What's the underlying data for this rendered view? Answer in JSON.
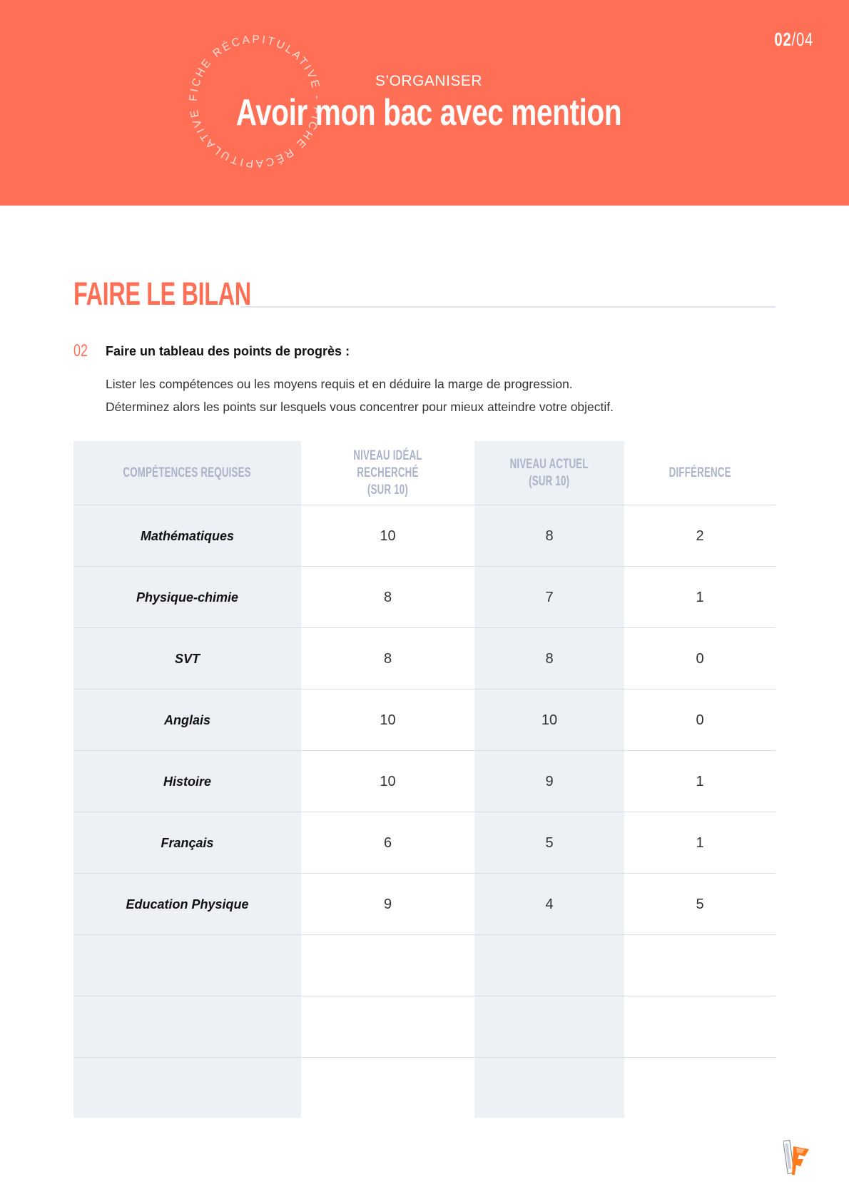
{
  "header": {
    "page_current": "02",
    "page_separator": "/",
    "page_total": "04",
    "stamp_text": "FICHE RÉCAPITULATIVE - FICHE RÉCAPITULATIVE - ",
    "kicker": "S’ORGANISER",
    "title": "Avoir mon bac avec mention",
    "banner_color": "#ff6f55"
  },
  "section": {
    "title": "FAIRE LE BILAN"
  },
  "step": {
    "number": "02",
    "title": "Faire un tableau des points de progrès :",
    "line1": "Lister les compétences ou les moyens requis et en déduire la marge de progression.",
    "line2": "Déterminez alors les points sur lesquels vous concentrer pour mieux atteindre votre objectif."
  },
  "table": {
    "headers": [
      "COMPÉTENCES REQUISES",
      "NIVEAU IDÉAL RECHERCHÉ\n(SUR 10)",
      "NIVEAU ACTUEL\n(SUR 10)",
      "DIFFÉRENCE"
    ],
    "rows": [
      {
        "subject": "Mathématiques",
        "ideal": "10",
        "current": "8",
        "diff": "2"
      },
      {
        "subject": "Physique-chimie",
        "ideal": "8",
        "current": "7",
        "diff": "1"
      },
      {
        "subject": "SVT",
        "ideal": "8",
        "current": "8",
        "diff": "0"
      },
      {
        "subject": "Anglais",
        "ideal": "10",
        "current": "10",
        "diff": "0"
      },
      {
        "subject": "Histoire",
        "ideal": "10",
        "current": "9",
        "diff": "1"
      },
      {
        "subject": "Français",
        "ideal": "6",
        "current": "5",
        "diff": "1"
      },
      {
        "subject": "Education Physique",
        "ideal": "9",
        "current": "4",
        "diff": "5"
      },
      {
        "subject": "",
        "ideal": "",
        "current": "",
        "diff": ""
      },
      {
        "subject": "",
        "ideal": "",
        "current": "",
        "diff": ""
      },
      {
        "subject": "",
        "ideal": "",
        "current": "",
        "diff": ""
      }
    ]
  },
  "footer": {
    "logo_icon": "brand-logo-icon"
  }
}
